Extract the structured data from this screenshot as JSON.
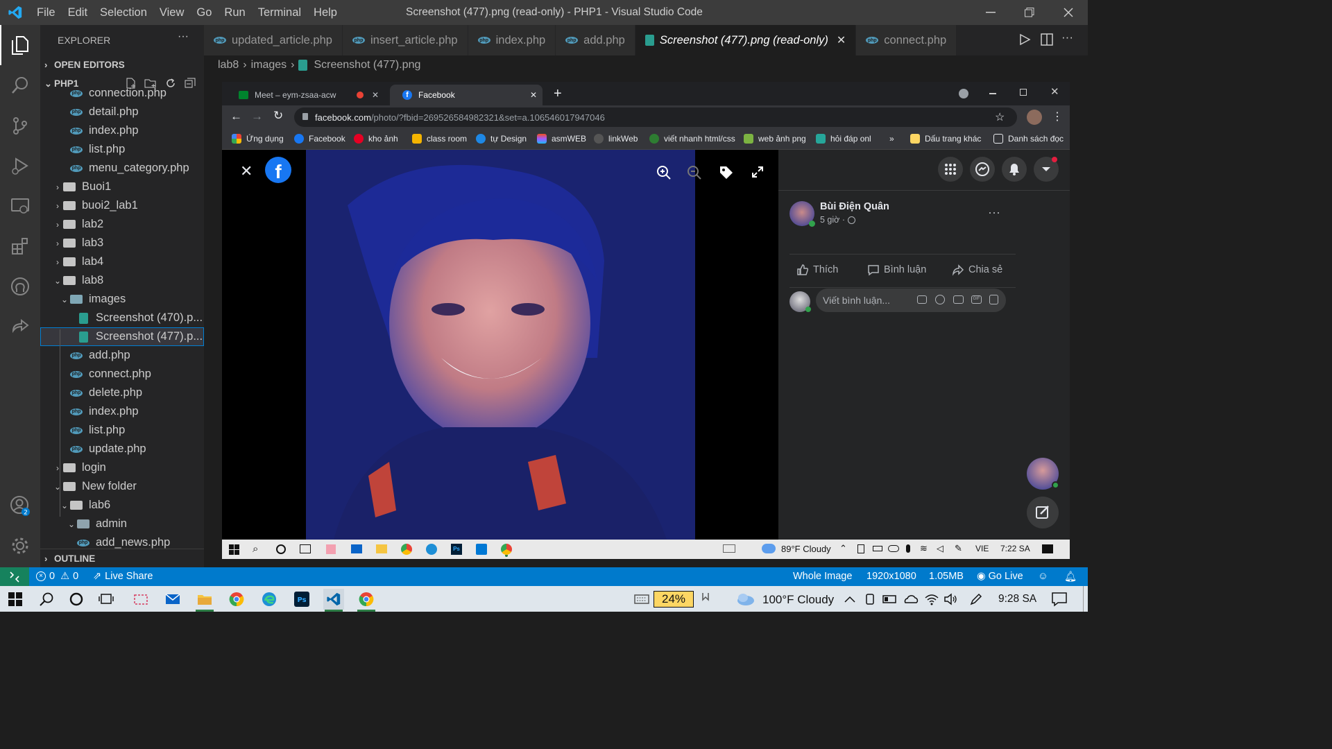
{
  "window": {
    "title": "Screenshot (477).png (read-only) - PHP1 - Visual Studio Code",
    "menu": [
      "File",
      "Edit",
      "Selection",
      "View",
      "Go",
      "Run",
      "Terminal",
      "Help"
    ]
  },
  "explorer": {
    "header": "EXPLORER",
    "open_editors": "OPEN EDITORS",
    "project": "PHP1",
    "outline": "OUTLINE",
    "tree": [
      {
        "label": "connection.php",
        "kind": "php",
        "depth": 2,
        "chev": ""
      },
      {
        "label": "detail.php",
        "kind": "php",
        "depth": 2,
        "chev": ""
      },
      {
        "label": "index.php",
        "kind": "php",
        "depth": 2,
        "chev": ""
      },
      {
        "label": "list.php",
        "kind": "php",
        "depth": 2,
        "chev": ""
      },
      {
        "label": "menu_category.php",
        "kind": "php",
        "depth": 2,
        "chev": ""
      },
      {
        "label": "Buoi1",
        "kind": "folder",
        "depth": 1,
        "chev": "›"
      },
      {
        "label": "buoi2_lab1",
        "kind": "folder",
        "depth": 1,
        "chev": "›"
      },
      {
        "label": "lab2",
        "kind": "folder",
        "depth": 1,
        "chev": "›"
      },
      {
        "label": "lab3",
        "kind": "folder",
        "depth": 1,
        "chev": "›"
      },
      {
        "label": "lab4",
        "kind": "folder",
        "depth": 1,
        "chev": "›"
      },
      {
        "label": "lab8",
        "kind": "folder",
        "depth": 1,
        "chev": "⌄"
      },
      {
        "label": "images",
        "kind": "folder-img",
        "depth": 2,
        "chev": "⌄"
      },
      {
        "label": "Screenshot (470).p...",
        "kind": "image",
        "depth": 3,
        "chev": ""
      },
      {
        "label": "Screenshot (477).p...",
        "kind": "image",
        "depth": 3,
        "chev": "",
        "selected": true
      },
      {
        "label": "add.php",
        "kind": "php",
        "depth": 2,
        "chev": ""
      },
      {
        "label": "connect.php",
        "kind": "php",
        "depth": 2,
        "chev": ""
      },
      {
        "label": "delete.php",
        "kind": "php",
        "depth": 2,
        "chev": ""
      },
      {
        "label": "index.php",
        "kind": "php",
        "depth": 2,
        "chev": ""
      },
      {
        "label": "list.php",
        "kind": "php",
        "depth": 2,
        "chev": ""
      },
      {
        "label": "update.php",
        "kind": "php",
        "depth": 2,
        "chev": ""
      },
      {
        "label": "login",
        "kind": "folder",
        "depth": 1,
        "chev": "›"
      },
      {
        "label": "New folder",
        "kind": "folder",
        "depth": 1,
        "chev": "⌄"
      },
      {
        "label": "lab6",
        "kind": "folder",
        "depth": 2,
        "chev": "⌄"
      },
      {
        "label": "admin",
        "kind": "folder-gear",
        "depth": 3,
        "chev": "⌄"
      },
      {
        "label": "add_news.php",
        "kind": "php",
        "depth": 3,
        "chev": ""
      }
    ]
  },
  "tabs": [
    {
      "label": "updated_article.php",
      "kind": "php"
    },
    {
      "label": "insert_article.php",
      "kind": "php"
    },
    {
      "label": "index.php",
      "kind": "php"
    },
    {
      "label": "add.php",
      "kind": "php"
    },
    {
      "label": "Screenshot (477).png (read-only)",
      "kind": "image",
      "active": true
    },
    {
      "label": "connect.php",
      "kind": "php"
    }
  ],
  "breadcrumb": [
    "lab8",
    "images",
    "Screenshot (477).png"
  ],
  "browser": {
    "tabs": [
      {
        "label": "Meet – eym-zsaa-acw"
      },
      {
        "label": "Facebook",
        "active": true
      }
    ],
    "url_domain": "facebook.com",
    "url_path": "/photo/?fbid=269526584982321&set=a.106546017947046",
    "bookmarks": [
      "Ứng dụng",
      "Facebook",
      "kho ảnh",
      "class room",
      "tự Design",
      "asmWEB",
      "linkWeb",
      "viết nhanh html/css",
      "web ảnh png",
      "hỏi đáp onl",
      "»",
      "Dấu trang khác",
      "Danh sách đọc"
    ]
  },
  "facebook": {
    "author": "Bùi Điện Quân",
    "time": "5 giờ ·",
    "like": "Thích",
    "comment": "Bình luận",
    "share": "Chia sẻ",
    "comment_placeholder": "Viết bình luận..."
  },
  "inner_taskbar": {
    "weather": "89°F  Cloudy",
    "lang": "VIE",
    "time": "7:22 SA"
  },
  "statusbar": {
    "errors": "0",
    "warnings": "0",
    "live_share": "Live Share",
    "zoom_mode": "Whole Image",
    "dimensions": "1920x1080",
    "size": "1.05MB",
    "go_live": "Go Live"
  },
  "os_taskbar": {
    "battery": "24%",
    "weather": "100°F  Cloudy",
    "time": "9:28 SA"
  },
  "colors": {
    "accent": "#007acc",
    "remote": "#16825d",
    "php": "#519aba",
    "fb": "#1877f2"
  }
}
